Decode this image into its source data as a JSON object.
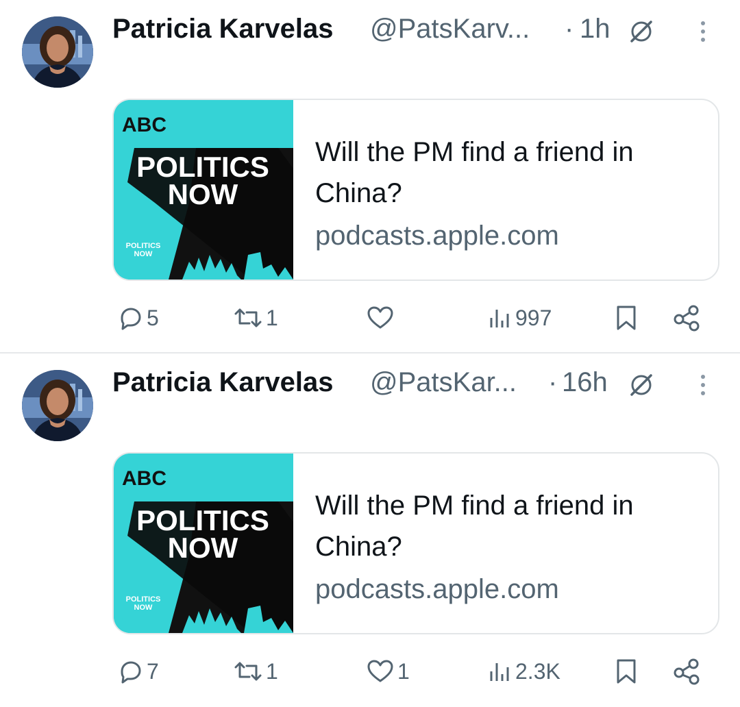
{
  "tweets": [
    {
      "author_name": "Patricia Karvelas",
      "handle": "@PatsKarv...",
      "separator": "·",
      "time": "1h",
      "card": {
        "thumb_logo": "ABC",
        "thumb_title_line1": "POLITICS",
        "thumb_title_line2": "NOW",
        "thumb_mini_line1": "POLITICS",
        "thumb_mini_line2": "NOW",
        "title": "Will the PM find a friend in China?",
        "domain": "podcasts.apple.com"
      },
      "replies": "5",
      "reposts": "1",
      "likes": "",
      "views": "997",
      "icons": [
        "reply-icon",
        "repost-icon",
        "like-icon",
        "views-icon",
        "bookmark-icon",
        "share-icon",
        "grok-icon",
        "more-icon"
      ]
    },
    {
      "author_name": "Patricia Karvelas",
      "handle": "@PatsKar...",
      "separator": "·",
      "time": "16h",
      "card": {
        "thumb_logo": "ABC",
        "thumb_title_line1": "POLITICS",
        "thumb_title_line2": "NOW",
        "thumb_mini_line1": "POLITICS",
        "thumb_mini_line2": "NOW",
        "title": "Will the PM find a friend in China?",
        "domain": "podcasts.apple.com"
      },
      "replies": "7",
      "reposts": "1",
      "likes": "1",
      "views": "2.3K",
      "icons": [
        "reply-icon",
        "repost-icon",
        "like-icon",
        "views-icon",
        "bookmark-icon",
        "share-icon",
        "grok-icon",
        "more-icon"
      ]
    }
  ],
  "colors": {
    "text_primary": "#0f1419",
    "text_secondary": "#536471",
    "card_border": "#e3e6e8",
    "thumb_teal": "#35d3d6"
  }
}
